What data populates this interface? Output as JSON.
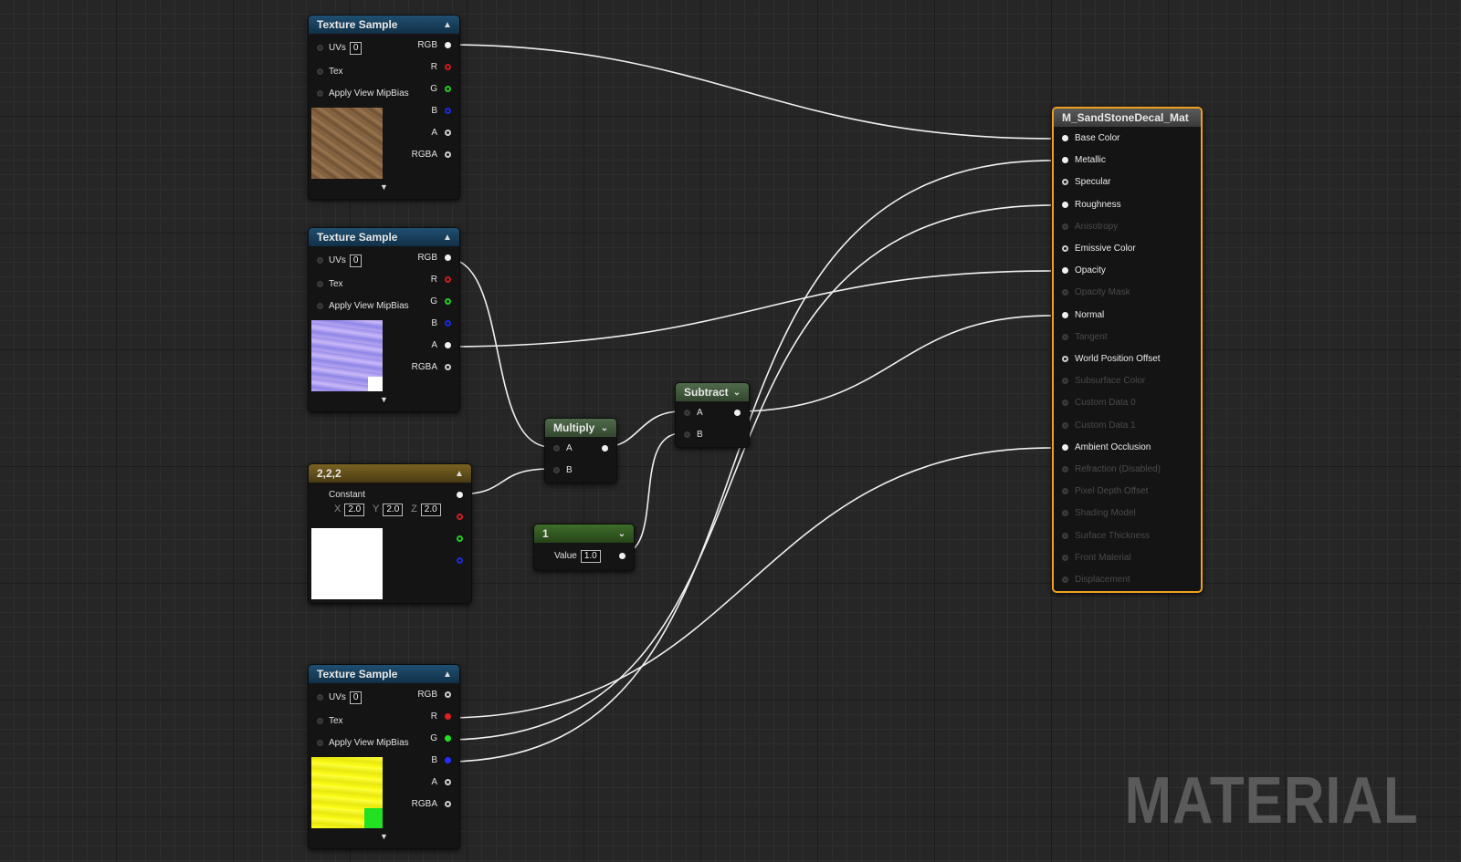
{
  "nodes": {
    "tex1": {
      "title": "Texture Sample",
      "uvs_label": "UVs",
      "uvs_value": "0",
      "tex_label": "Tex",
      "mip_label": "Apply View MipBias",
      "outputs": [
        "RGB",
        "R",
        "G",
        "B",
        "A",
        "RGBA"
      ]
    },
    "tex2": {
      "title": "Texture Sample",
      "uvs_label": "UVs",
      "uvs_value": "0",
      "tex_label": "Tex",
      "mip_label": "Apply View MipBias",
      "outputs": [
        "RGB",
        "R",
        "G",
        "B",
        "A",
        "RGBA"
      ]
    },
    "const3": {
      "title": "2,2,2",
      "label": "Constant",
      "x_label": "X",
      "x_value": "2.0",
      "y_label": "Y",
      "y_value": "2.0",
      "z_label": "Z",
      "z_value": "2.0"
    },
    "tex3": {
      "title": "Texture Sample",
      "uvs_label": "UVs",
      "uvs_value": "0",
      "tex_label": "Tex",
      "mip_label": "Apply View MipBias",
      "outputs": [
        "RGB",
        "R",
        "G",
        "B",
        "A",
        "RGBA"
      ]
    },
    "multiply": {
      "title": "Multiply",
      "input_a": "A",
      "input_b": "B"
    },
    "subtract": {
      "title": "Subtract",
      "input_a": "A",
      "input_b": "B"
    },
    "scalar": {
      "title": "1",
      "value_label": "Value",
      "value": "1.0"
    },
    "material": {
      "title": "M_SandStoneDecal_Mat",
      "inputs": [
        {
          "label": "Base Color",
          "active": true,
          "connected": true
        },
        {
          "label": "Metallic",
          "active": true,
          "connected": true
        },
        {
          "label": "Specular",
          "active": true,
          "connected": false
        },
        {
          "label": "Roughness",
          "active": true,
          "connected": true
        },
        {
          "label": "Anisotropy",
          "active": false,
          "connected": false
        },
        {
          "label": "Emissive Color",
          "active": true,
          "connected": false
        },
        {
          "label": "Opacity",
          "active": true,
          "connected": true
        },
        {
          "label": "Opacity Mask",
          "active": false,
          "connected": false
        },
        {
          "label": "Normal",
          "active": true,
          "connected": true
        },
        {
          "label": "Tangent",
          "active": false,
          "connected": false
        },
        {
          "label": "World Position Offset",
          "active": true,
          "connected": false
        },
        {
          "label": "Subsurface Color",
          "active": false,
          "connected": false
        },
        {
          "label": "Custom Data 0",
          "active": false,
          "connected": false
        },
        {
          "label": "Custom Data 1",
          "active": false,
          "connected": false
        },
        {
          "label": "Ambient Occlusion",
          "active": true,
          "connected": true
        },
        {
          "label": "Refraction (Disabled)",
          "active": false,
          "connected": false
        },
        {
          "label": "Pixel Depth Offset",
          "active": false,
          "connected": false
        },
        {
          "label": "Shading Model",
          "active": false,
          "connected": false
        },
        {
          "label": "Surface Thickness",
          "active": false,
          "connected": false
        },
        {
          "label": "Front Material",
          "active": false,
          "connected": false
        },
        {
          "label": "Displacement",
          "active": false,
          "connected": false
        }
      ]
    }
  },
  "watermark": "MATERIAL",
  "colors": {
    "accent_orange": "#f0a020",
    "pin_red": "#e02020",
    "pin_green": "#22e022",
    "pin_blue": "#2230ff",
    "scalar_header": "#3f6e2a"
  }
}
